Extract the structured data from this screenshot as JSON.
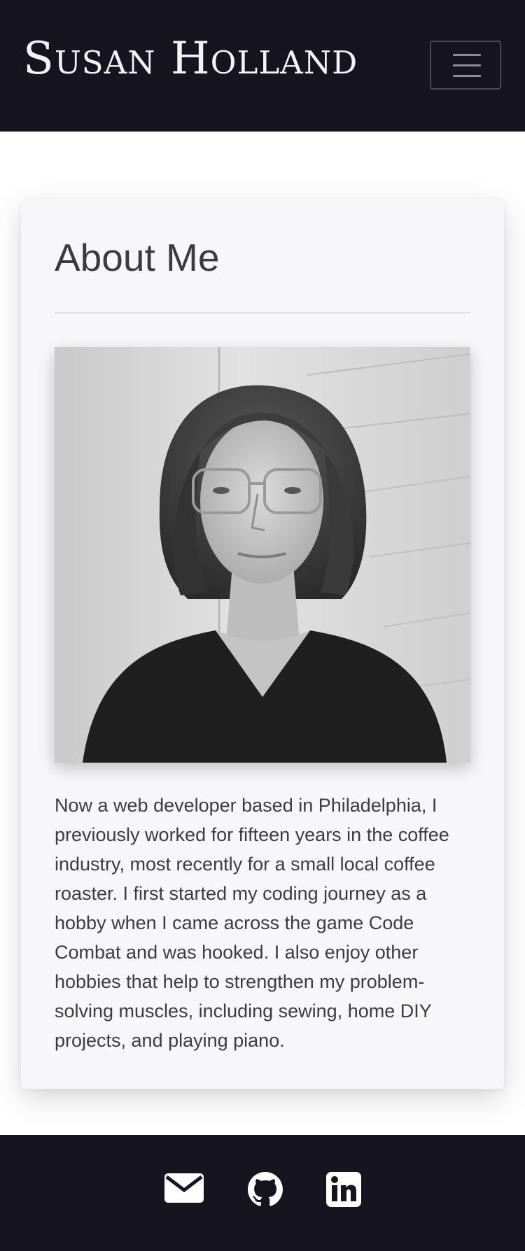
{
  "header": {
    "brand": "Susan Holland",
    "menu_icon": "hamburger-icon"
  },
  "about": {
    "title": "About Me",
    "photo_icon": "portrait-photo",
    "bio": "Now a web developer based in Philadelphia, I previously worked for fifteen years in the coffee industry, most recently for a small local coffee roaster. I first started my coding journey as a hobby when I came across the game Code Combat and was hooked. I also enjoy other hobbies that help to strengthen my problem-solving muscles, including sewing, home DIY projects, and playing piano."
  },
  "footer": {
    "links": [
      {
        "icon": "envelope-icon"
      },
      {
        "icon": "github-icon"
      },
      {
        "icon": "linkedin-icon"
      }
    ]
  },
  "colors": {
    "nav_bg": "#16141f",
    "card_bg": "#f7f7fa",
    "text": "#3d3d40"
  }
}
